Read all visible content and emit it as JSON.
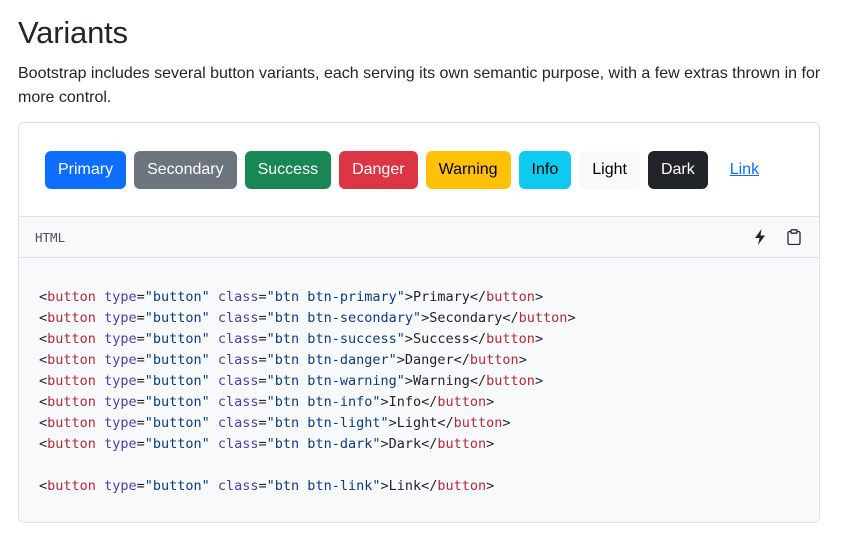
{
  "heading": "Variants",
  "description": "Bootstrap includes several button variants, each serving its own semantic purpose, with a few extras thrown in for more control.",
  "buttons": [
    {
      "label": "Primary",
      "cls": "btn-primary"
    },
    {
      "label": "Secondary",
      "cls": "btn-secondary"
    },
    {
      "label": "Success",
      "cls": "btn-success"
    },
    {
      "label": "Danger",
      "cls": "btn-danger"
    },
    {
      "label": "Warning",
      "cls": "btn-warning"
    },
    {
      "label": "Info",
      "cls": "btn-info"
    },
    {
      "label": "Light",
      "cls": "btn-light"
    },
    {
      "label": "Dark",
      "cls": "btn-dark"
    },
    {
      "label": "Link",
      "cls": "btn-link"
    }
  ],
  "code": {
    "language": "HTML",
    "icons": [
      "lightning-icon",
      "clipboard-icon"
    ],
    "lines": [
      {
        "cls": "btn btn-primary",
        "text": "Primary"
      },
      {
        "cls": "btn btn-secondary",
        "text": "Secondary"
      },
      {
        "cls": "btn btn-success",
        "text": "Success"
      },
      {
        "cls": "btn btn-danger",
        "text": "Danger"
      },
      {
        "cls": "btn btn-warning",
        "text": "Warning"
      },
      {
        "cls": "btn btn-info",
        "text": "Info"
      },
      {
        "cls": "btn btn-light",
        "text": "Light"
      },
      {
        "cls": "btn btn-dark",
        "text": "Dark"
      },
      {
        "blank": true
      },
      {
        "cls": "btn btn-link",
        "text": "Link"
      }
    ]
  },
  "colors": {
    "primary": "#0d6efd",
    "secondary": "#6c757d",
    "success": "#198754",
    "danger": "#dc3545",
    "warning": "#ffc107",
    "info": "#0dcaf0",
    "light": "#f8f9fa",
    "dark": "#212529"
  }
}
